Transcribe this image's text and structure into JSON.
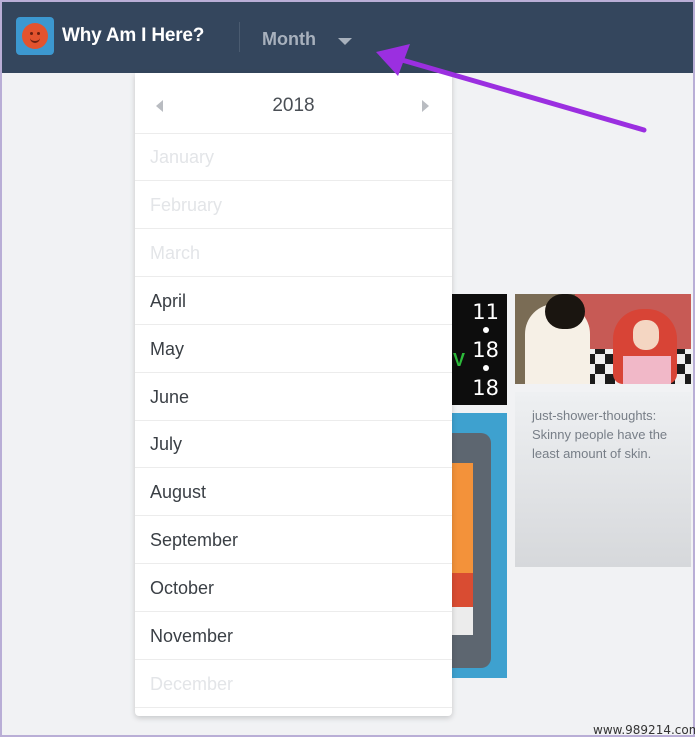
{
  "header": {
    "app_title": "Why Am I Here?",
    "logo_icon": "smiling-face-icon",
    "view_dropdown_label": "Month"
  },
  "month_picker": {
    "year": "2018",
    "months": [
      {
        "label": "January",
        "enabled": false
      },
      {
        "label": "February",
        "enabled": false
      },
      {
        "label": "March",
        "enabled": false
      },
      {
        "label": "April",
        "enabled": true
      },
      {
        "label": "May",
        "enabled": true
      },
      {
        "label": "June",
        "enabled": true
      },
      {
        "label": "July",
        "enabled": true
      },
      {
        "label": "August",
        "enabled": true
      },
      {
        "label": "September",
        "enabled": true
      },
      {
        "label": "October",
        "enabled": true
      },
      {
        "label": "November",
        "enabled": true
      },
      {
        "label": "December",
        "enabled": false
      }
    ]
  },
  "cards": {
    "clock": {
      "hour": "11",
      "minute": "18",
      "second": "18",
      "letter": "V"
    },
    "quote": "just-shower-thoughts: Skinny people have the least amount of skin."
  },
  "annotation": {
    "arrow_color": "#9b2fe0"
  },
  "watermark": "www.989214.com",
  "colors": {
    "header_bg": "#34465d",
    "page_bg": "#f1f2f4",
    "logo_bg": "#3c98d0",
    "logo_face": "#e3532e"
  }
}
